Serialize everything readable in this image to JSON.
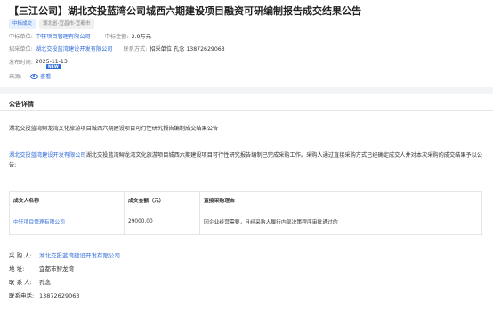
{
  "title": "【三江公司】湖北交投蓝湾公司城西六期建设项目融资可研编制报告成交结果公告",
  "tags": [
    "中标成交",
    "湖北省-宜昌市-宜都市"
  ],
  "meta": {
    "winner_label": "中标单位:",
    "winner_value": "中轩项目管理有限公司",
    "amount_label": "中标金额:",
    "amount_value": "2.9万元",
    "tenderer_label": "招采单位:",
    "tenderer_value": "湖北交投蓝湾建设开发有限公司",
    "contact_label": "联系方式:",
    "contact_value": "招采单位  孔念  13872629063",
    "publish_label": "发布时间:",
    "publish_value": "2025-11-13",
    "source_label": "来源:",
    "badge": "NEW",
    "view_label": "查看"
  },
  "section_title": "公告详情",
  "body": {
    "project_line": "湖北交投蓝湾鲟龙湾文化旅游项目城西六期建设项目可行性研究报告编制成交结果公告",
    "para_link": "湖北交投蓝湾建设开发有限公司",
    "para_rest": "湖北交投蓝湾鲟龙湾文化旅游项目城西六期建设项目可行性研究报告编制已完成采购工作。采购人通过直接采购方式已经确定成交人并对本次采购的成交结果予以公告:"
  },
  "table": {
    "headers": [
      "成交人名称",
      "成交金额（元）",
      "直接采购理由"
    ],
    "rows": [
      [
        "中轩项目管理有限公司",
        "29000.00",
        "因企业经营需要，且经采购人履行内部决策程序审批通过的"
      ]
    ]
  },
  "contact": {
    "buyer_label": "采 购 人:",
    "buyer_value": "湖北交投蓝湾建设开发有限公司",
    "address_label": "地    址:",
    "address_value": "宜都市鲟龙湾",
    "person_label": "联 系 人:",
    "person_value": "孔念",
    "phone_label": "联系电话:",
    "phone_value": "13872629063"
  },
  "colors": {
    "link": "#2f6bd8",
    "tag_bg": "#e6f0ff"
  }
}
